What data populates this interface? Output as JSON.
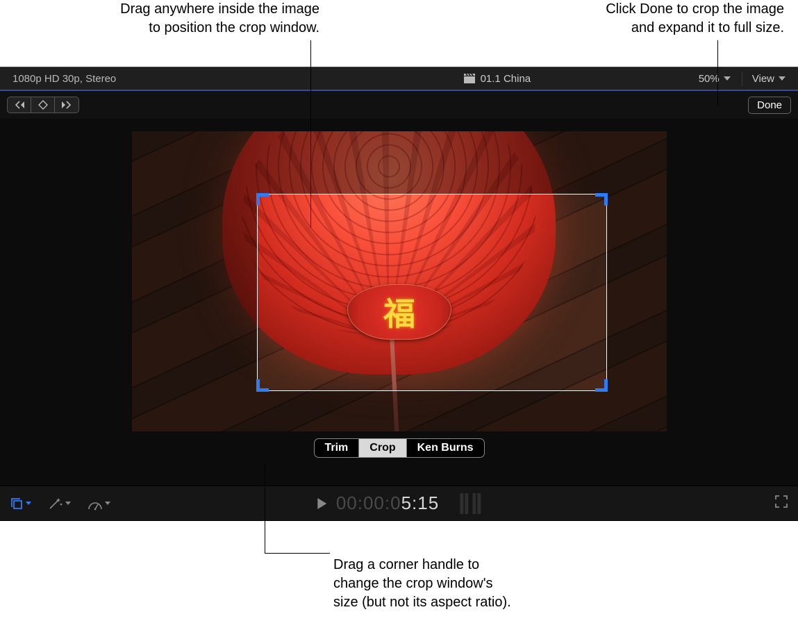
{
  "callouts": {
    "top_left_l1": "Drag anywhere inside the image",
    "top_left_l2": "to position the crop window.",
    "top_right_l1": "Click Done to crop the image",
    "top_right_l2": "and expand it to full size.",
    "bottom_l1": "Drag a corner handle to",
    "bottom_l2": "change the crop window's",
    "bottom_l3": "size (but not its aspect ratio)."
  },
  "info": {
    "format": "1080p HD 30p, Stereo",
    "clip_name": "01.1 China",
    "zoom": "50%",
    "view_label": "View"
  },
  "toolrow": {
    "done": "Done"
  },
  "modes": {
    "trim": "Trim",
    "crop": "Crop",
    "kenburns": "Ken Burns"
  },
  "fu_char": "福",
  "timecode": {
    "dim": "00:00:0",
    "bright": "5:15"
  }
}
